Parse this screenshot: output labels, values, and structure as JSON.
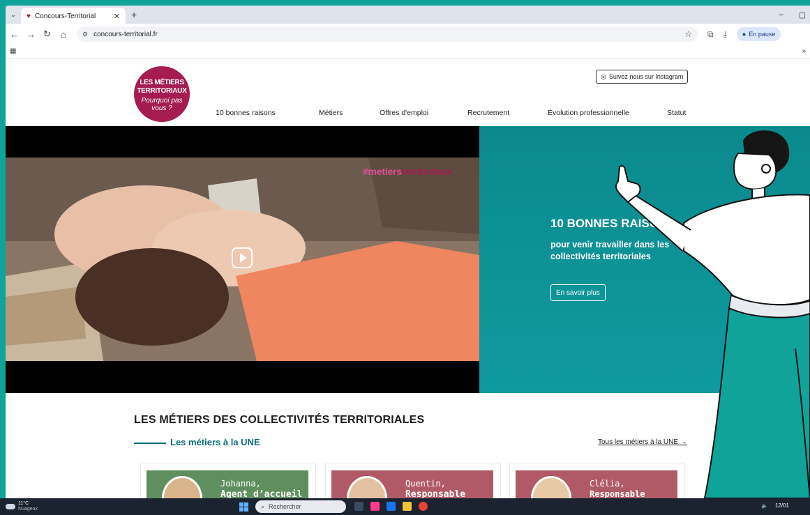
{
  "browser": {
    "tab_title": "Concours-Territorial",
    "new_tab": "+",
    "url": "concours-territorial.fr",
    "pause_label": "En pause",
    "win_min": "–",
    "win_max": "▢"
  },
  "header": {
    "logo_line1": "LES MÉTIERS",
    "logo_line2": "TERRITORIAUX",
    "logo_line3": "Pourquoi pas",
    "logo_line4": "vous ?",
    "instagram_label": "Suivez nous sur Instagram",
    "menu": [
      "10 bonnes raisons",
      "Métiers",
      "Offres d'emploi",
      "Recrutement",
      "Évolution professionnelle",
      "Statut"
    ]
  },
  "hero": {
    "hashtag_part1": "#metiers",
    "hashtag_part2": "territoriaux",
    "title": "10 BONNES RAISONS",
    "subtitle_line1": "pour venir travailler dans les",
    "subtitle_line2": "collectivités territoriales",
    "cta": "En savoir plus"
  },
  "section": {
    "title": "LES MÉTIERS DES COLLECTIVITÉS TERRITORIALES",
    "une_title": "Les métiers à la UNE",
    "une_link": "Tous les métiers à la UNE →",
    "cards": [
      {
        "name": "Johanna,",
        "job": "Agent d’accueil",
        "bg": "#5f8f5f"
      },
      {
        "name": "Quentin,",
        "job": "Responsable",
        "bg": "#b15a67"
      },
      {
        "name": "Clélia,",
        "job": "Responsable",
        "bg": "#b15a67"
      }
    ]
  },
  "taskbar": {
    "temp": "11°C",
    "weather": "Nuageux",
    "search_placeholder": "Rechercher",
    "date": "12/01"
  }
}
